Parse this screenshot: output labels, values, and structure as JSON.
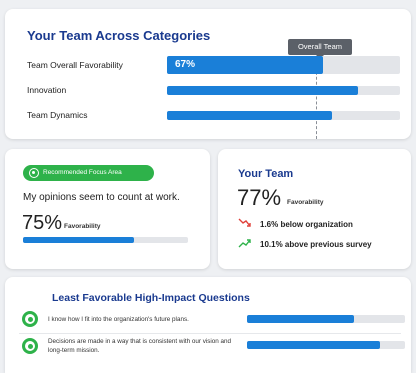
{
  "team_card": {
    "title": "Your Team Across Categories",
    "tooltip": "Overall Team",
    "rows": [
      {
        "label": "Team Overall Favorability",
        "value_label": "67%",
        "fill_fraction": 0.67,
        "benchmark_fraction": 0.67
      },
      {
        "label": "Innovation",
        "fill_fraction": 0.82
      },
      {
        "label": "Team Dynamics",
        "fill_fraction": 0.71
      }
    ]
  },
  "focus_card": {
    "badge": "Recommended Focus Area",
    "statement": "My opinions seem to count at work.",
    "value": "75%",
    "value_label": "Favorability",
    "fill_fraction": 0.67
  },
  "your_team_card": {
    "title": "Your Team",
    "value": "77%",
    "value_label": "Favorability",
    "deltas": [
      {
        "text": "1.6% below organization",
        "direction": "down",
        "color": "#e0413a"
      },
      {
        "text": "10.1% above previous survey",
        "direction": "up",
        "color": "#2eb24a"
      }
    ]
  },
  "least_card": {
    "title": "Least Favorable High-Impact Questions",
    "questions": [
      {
        "text": "I know how I fit into the organization's future plans.",
        "fill_fraction": 0.68
      },
      {
        "text": "Decisions are made in a way that is consistent with our vision and long-term mission.",
        "fill_fraction": 0.84
      }
    ]
  },
  "colors": {
    "accent_blue": "#1a7fd8",
    "title_navy": "#1a3a8f",
    "green": "#2eb24a",
    "red": "#e0413a",
    "track": "#e3e5e9"
  }
}
